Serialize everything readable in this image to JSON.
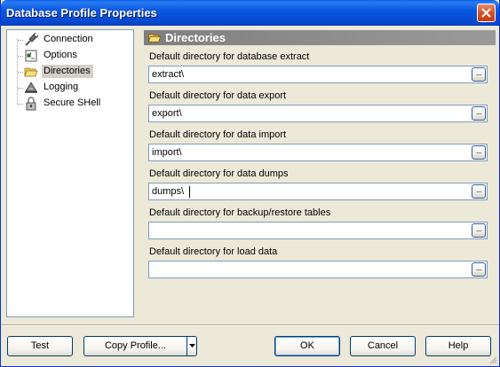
{
  "window": {
    "title": "Database Profile Properties"
  },
  "tree": {
    "items": [
      {
        "label": "Connection",
        "icon": "plug-icon",
        "selected": false
      },
      {
        "label": "Options",
        "icon": "options-icon",
        "selected": false
      },
      {
        "label": "Directories",
        "icon": "folder-open-icon",
        "selected": true
      },
      {
        "label": "Logging",
        "icon": "logging-icon",
        "selected": false
      },
      {
        "label": "Secure SHell",
        "icon": "lock-icon",
        "selected": false
      }
    ]
  },
  "section": {
    "title": "Directories",
    "icon": "folder-open-icon"
  },
  "fields": [
    {
      "label": "Default directory for database extract",
      "value": "extract\\"
    },
    {
      "label": "Default directory for data export",
      "value": "export\\"
    },
    {
      "label": "Default directory for data import",
      "value": "import\\"
    },
    {
      "label": "Default directory for data dumps",
      "value": "dumps\\"
    },
    {
      "label": "Default directory for backup/restore tables",
      "value": ""
    },
    {
      "label": "Default directory for load data",
      "value": ""
    }
  ],
  "browse_label": "...",
  "buttons": {
    "test": "Test",
    "copy_profile": "Copy Profile...",
    "ok": "OK",
    "cancel": "Cancel",
    "help": "Help"
  },
  "colors": {
    "titlebar": "#0548d0",
    "selection": "#d4d0c8",
    "section_header": "#808080",
    "dialog_bg": "#ece9d8"
  }
}
